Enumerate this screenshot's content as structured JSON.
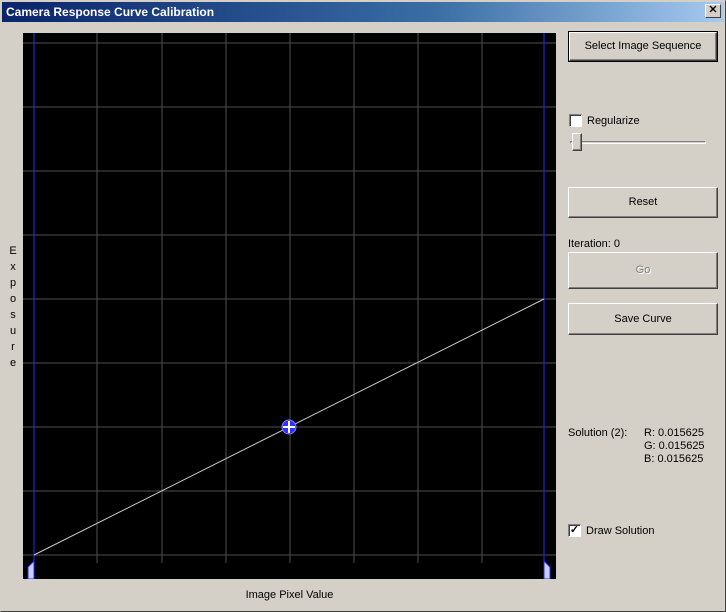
{
  "window": {
    "title": "Camera Response Curve Calibration",
    "close_label": "✕"
  },
  "plot": {
    "xlabel": "Image Pixel Value",
    "ylabel": "E\nx\np\no\ns\nu\nr\ne",
    "background": "#000000",
    "grid_color": "#505050",
    "curve_color": "#c8c8c8",
    "marker_color": "#3030ff"
  },
  "controls": {
    "select_sequence_label": "Select Image Sequence",
    "regularize_label": "Regularize",
    "regularize_checked": false,
    "reset_label": "Reset",
    "iteration_label": "Iteration: 0",
    "go_label": "Go",
    "save_curve_label": "Save Curve",
    "draw_solution_label": "Draw Solution",
    "draw_solution_checked": true
  },
  "solution": {
    "label": "Solution (2):",
    "r": "R: 0.015625",
    "g": "G: 0.015625",
    "b": "B: 0.015625"
  }
}
